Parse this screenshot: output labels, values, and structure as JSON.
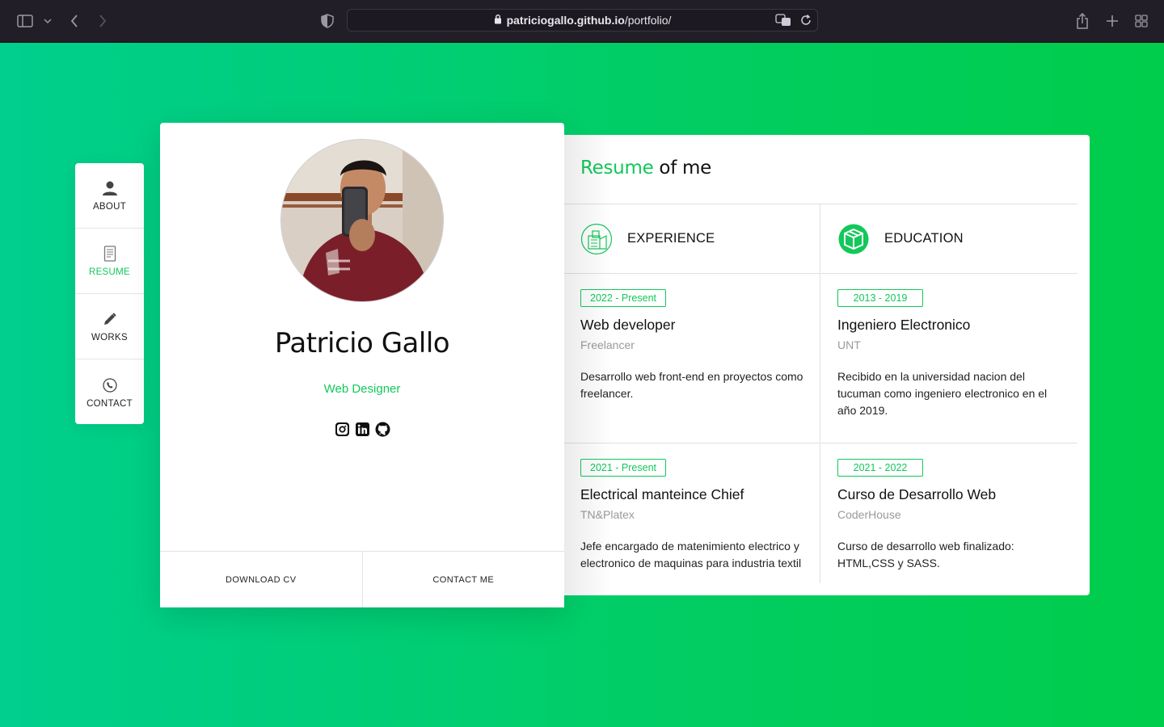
{
  "browser": {
    "url_host": "patriciogallo.github.io",
    "url_path": "/portfolio/"
  },
  "nav": {
    "items": [
      {
        "label": "ABOUT",
        "icon": "user-icon",
        "active": false
      },
      {
        "label": "RESUME",
        "icon": "document-icon",
        "active": true
      },
      {
        "label": "WORKS",
        "icon": "pencil-icon",
        "active": false
      },
      {
        "label": "CONTACT",
        "icon": "phone-icon",
        "active": false
      }
    ]
  },
  "profile": {
    "name": "Patricio Gallo",
    "role": "Web Designer",
    "socials": [
      "instagram-icon",
      "linkedin-icon",
      "github-icon"
    ],
    "download_label": "DOWNLOAD CV",
    "contact_label": "CONTACT ME"
  },
  "resume": {
    "title_highlight": "Resume",
    "title_rest": " of me",
    "experience": {
      "heading": "EXPERIENCE",
      "entries": [
        {
          "date": "2022 - Present",
          "title": "Web developer",
          "place": "Freelancer",
          "desc": "Desarrollo web front-end en proyectos como freelancer."
        },
        {
          "date": "2021 - Present",
          "title": "Electrical manteince Chief",
          "place": "TN&Platex",
          "desc": "Jefe encargado de matenimiento electrico y electronico de maquinas para industria textil"
        }
      ]
    },
    "education": {
      "heading": "EDUCATION",
      "entries": [
        {
          "date": "2013 - 2019",
          "title": "Ingeniero Electronico",
          "place": "UNT",
          "desc": "Recibido en la universidad nacion del tucuman como ingeniero electronico en el año 2019."
        },
        {
          "date": "2021 - 2022",
          "title": "Curso de Desarrollo Web",
          "place": "CoderHouse",
          "desc": "Curso de desarrollo web finalizado: HTML,CSS y SASS."
        }
      ]
    }
  },
  "colors": {
    "accent": "#12c85a",
    "bg_start": "#00cf8e",
    "bg_end": "#00cd4b"
  }
}
